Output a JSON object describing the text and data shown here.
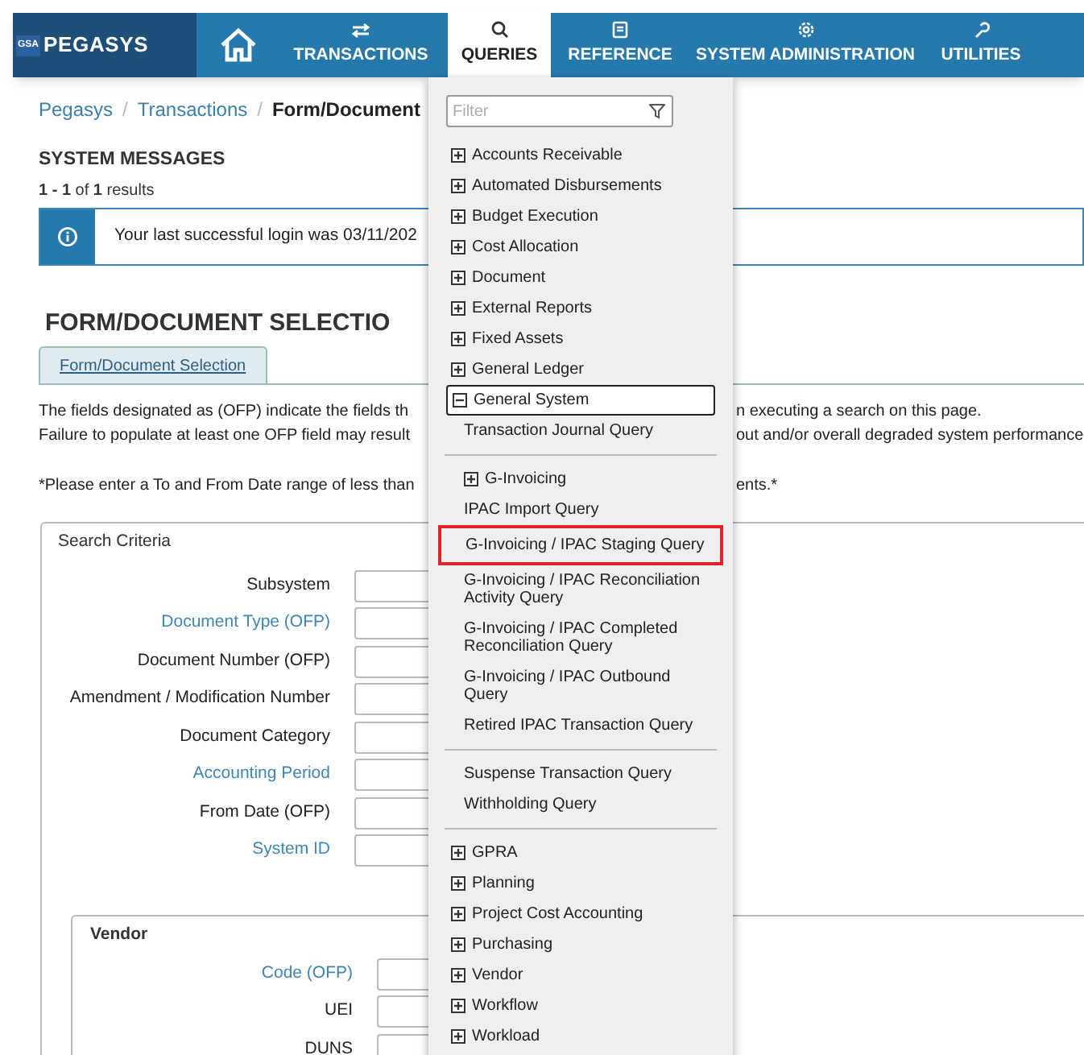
{
  "logo": {
    "badge": "GSA",
    "name": "PEGASYS"
  },
  "nav": [
    {
      "kind": "home",
      "selected": false
    },
    {
      "kind": "transfer",
      "label": "TRANSACTIONS",
      "selected": false
    },
    {
      "kind": "search",
      "label": "QUERIES",
      "selected": true
    },
    {
      "kind": "book",
      "label": "REFERENCE",
      "selected": false
    },
    {
      "kind": "gear",
      "label": "SYSTEM ADMINISTRATION",
      "selected": false
    },
    {
      "kind": "wrench",
      "label": "UTILITIES",
      "selected": false
    }
  ],
  "breadcrumb": [
    {
      "kind": "link",
      "text": "Pegasys"
    },
    {
      "kind": "separator",
      "text": "/"
    },
    {
      "kind": "link",
      "text": "Transactions"
    },
    {
      "kind": "separator",
      "text": "/"
    },
    {
      "kind": "current",
      "text": "Form/Document"
    }
  ],
  "system_messages": {
    "title": "SYSTEM MESSAGES",
    "count": "**1 - 1** of **1** results",
    "messages": [
      {
        "text": "Your last successful login was 03/11/202"
      }
    ]
  },
  "page_title": "FORM/DOCUMENT SELECTIO",
  "tabs": [
    {
      "label": "Form/Document Selection",
      "selected": true
    }
  ],
  "notes": [
    {
      "kind": "line",
      "left": "The fields designated as (OFP) indicate the fields th",
      "right": "n executing a search on this page."
    },
    {
      "kind": "line",
      "left": "Failure to populate at least one OFP field may result",
      "right": "out and/or overall degraded system performance"
    },
    {
      "kind": "blank"
    },
    {
      "kind": "line",
      "left": "*Please enter a To and From Date range of less than",
      "right": "ents.*"
    }
  ],
  "search_criteria": {
    "title": "Search Criteria",
    "fields": [
      {
        "label": "Subsystem",
        "linked": false
      },
      {
        "label": "Document Type (OFP)",
        "linked": true
      },
      {
        "label": "Document Number (OFP)",
        "linked": false
      },
      {
        "label": "Amendment / Modification Number",
        "linked": false
      },
      {
        "label": "Document Category",
        "linked": false
      },
      {
        "label": "Accounting Period",
        "linked": true
      },
      {
        "label": "From Date (OFP)",
        "linked": false
      },
      {
        "label": "System ID",
        "linked": true
      }
    ]
  },
  "vendor": {
    "title": "Vendor",
    "fields": [
      {
        "label": "Code (OFP)",
        "linked": true
      },
      {
        "label": "UEI",
        "linked": false
      },
      {
        "label": "DUNS",
        "linked": false
      }
    ]
  },
  "menu": {
    "filter_placeholder": "Filter",
    "items": [
      {
        "kind": "group",
        "label": "Accounts Receivable",
        "expanded": false
      },
      {
        "kind": "group",
        "label": "Automated Disbursements",
        "expanded": false
      },
      {
        "kind": "group",
        "label": "Budget Execution",
        "expanded": false
      },
      {
        "kind": "group",
        "label": "Cost Allocation",
        "expanded": false
      },
      {
        "kind": "group",
        "label": "Document",
        "expanded": false
      },
      {
        "kind": "group",
        "label": "External Reports",
        "expanded": false
      },
      {
        "kind": "group",
        "label": "Fixed Assets",
        "expanded": false
      },
      {
        "kind": "group",
        "label": "General Ledger",
        "expanded": false
      },
      {
        "kind": "group",
        "label": "General System",
        "expanded": true,
        "children": [
          {
            "kind": "query",
            "label": "Transaction Journal Query",
            "highlighted": false
          },
          {
            "kind": "separator"
          },
          {
            "kind": "group",
            "label": "G-Invoicing",
            "expanded": false
          },
          {
            "kind": "query",
            "label": "IPAC Import Query",
            "highlighted": false
          },
          {
            "kind": "query",
            "label": "G-Invoicing / IPAC Staging Query",
            "highlighted": true
          },
          {
            "kind": "query",
            "label": "G-Invoicing / IPAC Reconciliation Activity Query",
            "highlighted": false
          },
          {
            "kind": "query",
            "label": "G-Invoicing / IPAC Completed Reconciliation Query",
            "highlighted": false
          },
          {
            "kind": "query",
            "label": "G-Invoicing / IPAC Outbound Query",
            "highlighted": false
          },
          {
            "kind": "query",
            "label": "Retired IPAC Transaction Query",
            "highlighted": false
          },
          {
            "kind": "separator"
          },
          {
            "kind": "query",
            "label": "Suspense Transaction Query",
            "highlighted": false
          },
          {
            "kind": "query",
            "label": "Withholding Query",
            "highlighted": false
          },
          {
            "kind": "separator"
          }
        ]
      },
      {
        "kind": "group",
        "label": "GPRA",
        "expanded": false
      },
      {
        "kind": "group",
        "label": "Planning",
        "expanded": false
      },
      {
        "kind": "group",
        "label": "Project Cost Accounting",
        "expanded": false
      },
      {
        "kind": "group",
        "label": "Purchasing",
        "expanded": false
      },
      {
        "kind": "group",
        "label": "Vendor",
        "expanded": false
      },
      {
        "kind": "group",
        "label": "Workflow",
        "expanded": false
      },
      {
        "kind": "group",
        "label": "Workload",
        "expanded": false
      }
    ]
  }
}
